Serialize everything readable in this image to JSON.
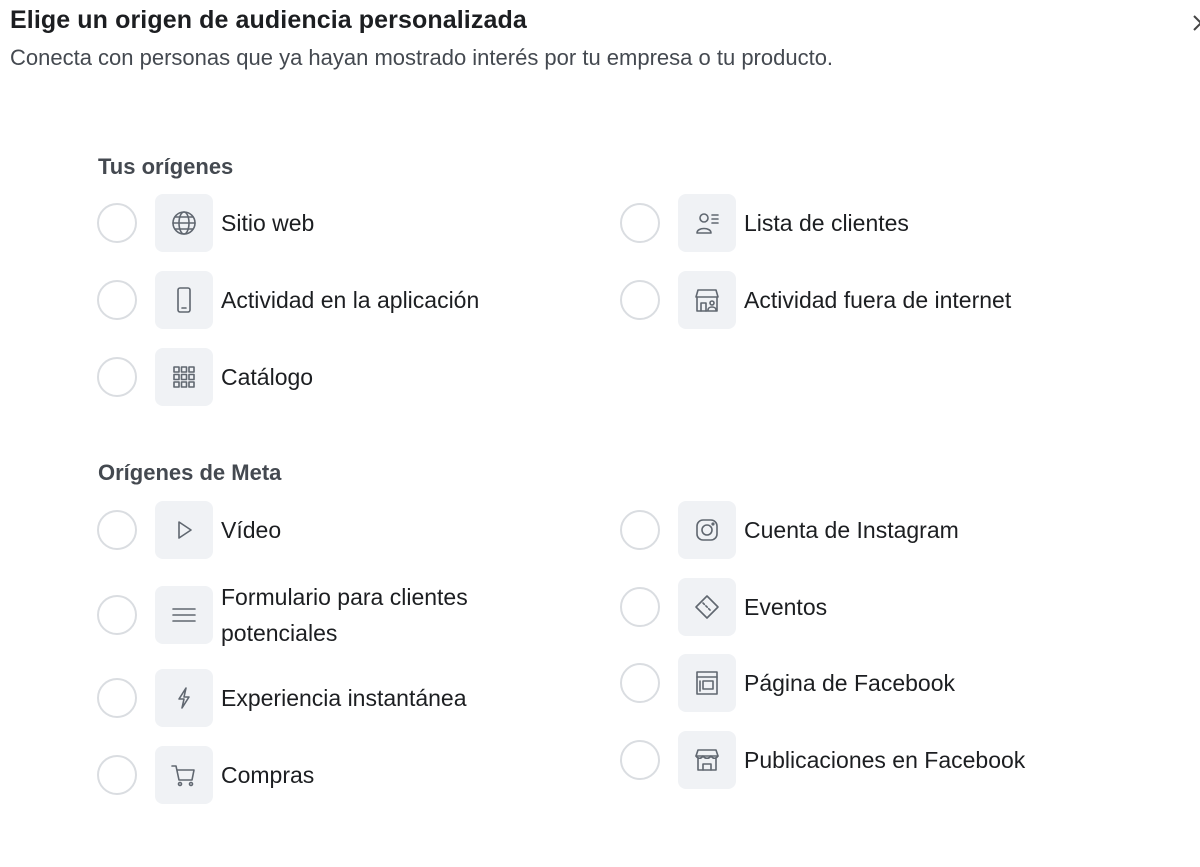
{
  "dialog": {
    "title": "Elige un origen de audiencia personalizada",
    "subtitle": "Conecta con personas que ya hayan mostrado interés por tu empresa o tu producto.",
    "close_icon": "close-icon"
  },
  "your_sources": {
    "heading": "Tus orígenes",
    "items": [
      {
        "label": "Sitio web",
        "icon": "globe-icon"
      },
      {
        "label": "Lista de clientes",
        "icon": "customer-list-icon"
      },
      {
        "label": "Actividad en la aplicación",
        "icon": "mobile-phone-icon"
      },
      {
        "label": "Actividad fuera de internet",
        "icon": "store-person-icon"
      },
      {
        "label": "Catálogo",
        "icon": "grid-icon"
      }
    ]
  },
  "meta_sources": {
    "heading": "Orígenes de Meta",
    "items": [
      {
        "label": "Vídeo",
        "icon": "play-icon"
      },
      {
        "label": "Cuenta de Instagram",
        "icon": "instagram-icon"
      },
      {
        "label": "Formulario para clientes potenciales",
        "icon": "lines-icon"
      },
      {
        "label": "Eventos",
        "icon": "ticket-icon"
      },
      {
        "label": "Experiencia instantánea",
        "icon": "lightning-icon"
      },
      {
        "label": "Página de Facebook",
        "icon": "page-icon"
      },
      {
        "label": "Compras",
        "icon": "cart-icon"
      },
      {
        "label": "Publicaciones en Facebook",
        "icon": "shop-icon"
      }
    ]
  }
}
